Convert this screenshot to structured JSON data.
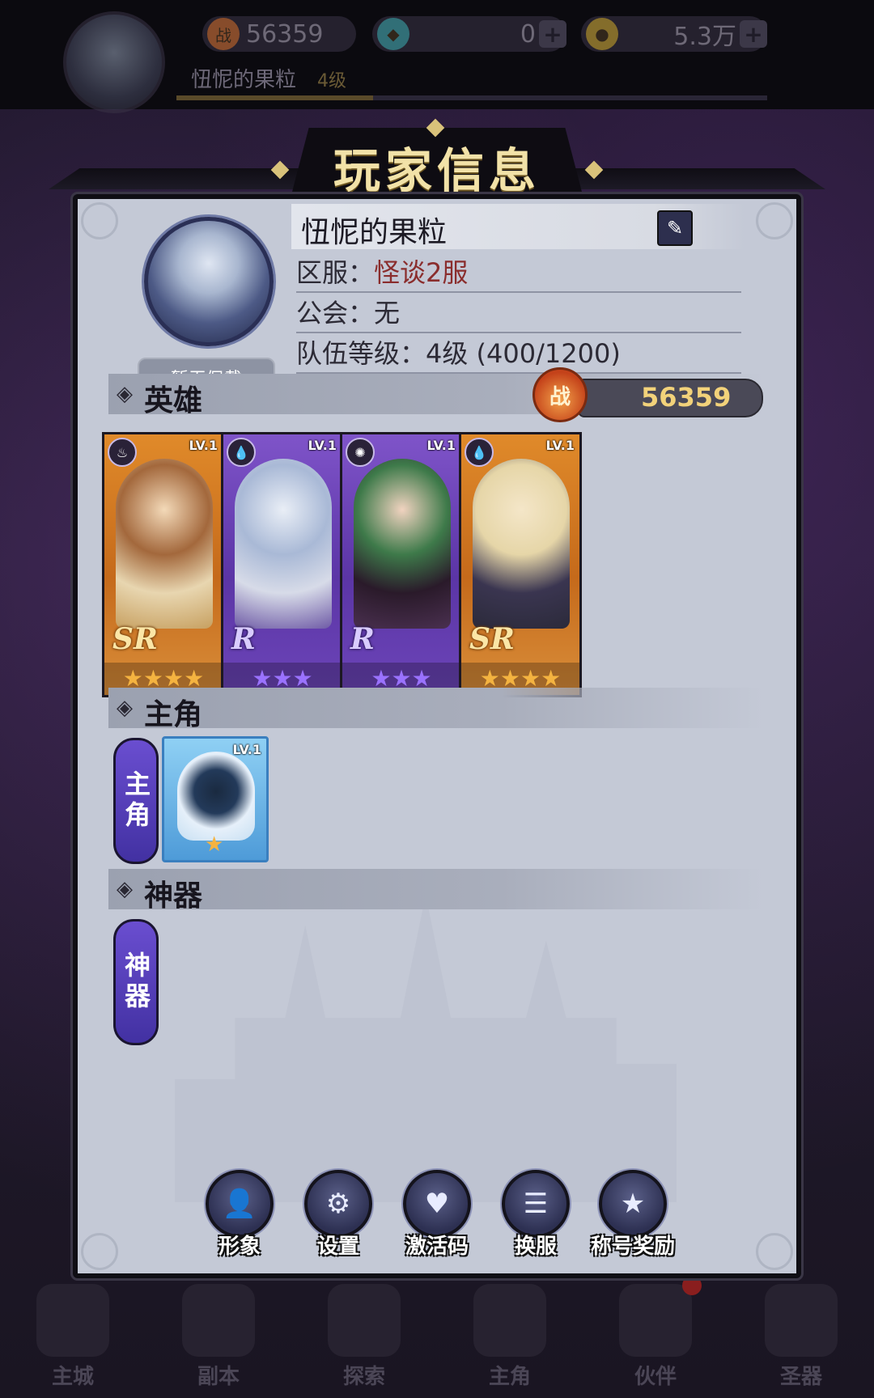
{
  "topbar": {
    "power": "56359",
    "gems": "0",
    "gold": "5.3万",
    "player_name": "忸怩的果粒",
    "player_level": "4级",
    "exp_fraction": 0.333
  },
  "modal": {
    "title": "玩家信息",
    "avatar_frame_label": "暂无佩戴",
    "player_name": "忸怩的果粒",
    "server_label": "区服：",
    "server_value": "怪谈2服",
    "guild_label": "公会：",
    "guild_value": "无",
    "team_level_label": "队伍等级：",
    "team_level_value": "4级 (400/1200)",
    "sections": {
      "heroes": "英雄",
      "protagonist": "主角",
      "artifact": "神器"
    },
    "power_icon_char": "战",
    "power_value": "56359",
    "heroes": [
      {
        "level": "LV.1",
        "rarity": "SR",
        "stars": 4,
        "stars_text": "★★★★",
        "element": "fire-icon",
        "element_glyph": "♨"
      },
      {
        "level": "LV.1",
        "rarity": "R",
        "stars": 3,
        "stars_text": "★★★",
        "element": "water-icon",
        "element_glyph": "💧"
      },
      {
        "level": "LV.1",
        "rarity": "R",
        "stars": 3,
        "stars_text": "★★★",
        "element": "wind-icon",
        "element_glyph": "✺"
      },
      {
        "level": "LV.1",
        "rarity": "SR",
        "stars": 4,
        "stars_text": "★★★★",
        "element": "water-icon",
        "element_glyph": "💧"
      }
    ],
    "protagonist_tag": "主角",
    "protagonist_card": {
      "level": "LV.1",
      "stars": 1,
      "stars_text": "★"
    },
    "artifact_tag": "神器",
    "actions": [
      {
        "label": "形象",
        "icon": "avatar-icon",
        "glyph": "👤"
      },
      {
        "label": "设置",
        "icon": "gear-icon",
        "glyph": "⚙"
      },
      {
        "label": "激活码",
        "icon": "gift-code-icon",
        "glyph": "♥"
      },
      {
        "label": "换服",
        "icon": "server-icon",
        "glyph": "☰"
      },
      {
        "label": "称号奖励",
        "icon": "title-badge-icon",
        "glyph": "★"
      }
    ]
  },
  "bottom_nav": [
    {
      "label": "主城"
    },
    {
      "label": "副本"
    },
    {
      "label": "探索"
    },
    {
      "label": "主角"
    },
    {
      "label": "伙伴",
      "has_badge": true
    },
    {
      "label": "圣器"
    }
  ],
  "colors": {
    "panel_bg": "#c4c9d6",
    "title_gold": "#f2e2a8",
    "server_red": "#8a2d2d",
    "sr_orange": "#e08a2a",
    "r_purple": "#7f54c9",
    "power_gold": "#f2d27a"
  }
}
